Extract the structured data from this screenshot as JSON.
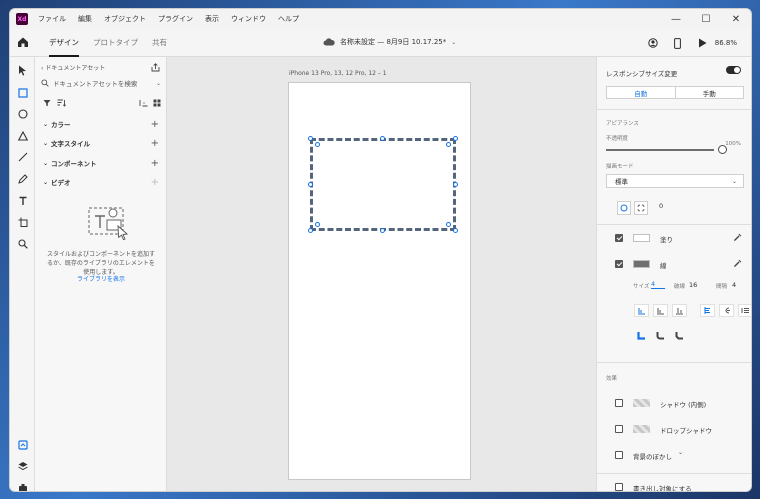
{
  "app": {
    "logo": "Xd",
    "menu": [
      "ファイル",
      "編集",
      "オブジェクト",
      "プラグイン",
      "表示",
      "ウィンドウ",
      "ヘルプ"
    ],
    "window_controls": [
      "—",
      "☐",
      "✕"
    ]
  },
  "toolbar": {
    "tabs": [
      "デザイン",
      "プロトタイプ",
      "共有"
    ],
    "document_title": "名称未設定 — 8月9日 10.17.25",
    "document_title_suffix": "*",
    "zoom": "86.8%"
  },
  "assets": {
    "breadcrumb": "ドキュメントアセット",
    "search_placeholder": "ドキュメントアセットを検索",
    "sections": [
      {
        "label": "カラー"
      },
      {
        "label": "文字スタイル"
      },
      {
        "label": "コンポーネント"
      },
      {
        "label": "ビデオ"
      }
    ],
    "empty_text": "スタイルおよびコンポーネントを追加するか、既存のライブラリのエレメントを使用します。",
    "library_link": "ライブラリを表示"
  },
  "canvas": {
    "artboard_title": "iPhone 13 Pro, 13, 12 Pro, 12 – 1"
  },
  "inspector": {
    "responsive_resize": "レスポンシブサイズ変更",
    "responsive_on": true,
    "mode_auto": "自動",
    "mode_manual": "手動",
    "appearance_heading": "アピアランス",
    "opacity_label": "不透明度",
    "opacity_value": "100%",
    "blend_label": "描画モード",
    "blend_value": "標準",
    "corner_radius": "0",
    "fill_label": "塗り",
    "fill_checked": true,
    "fill_color": "#ffffff",
    "border_label": "線",
    "border_checked": true,
    "border_color": "#707070",
    "size_label": "サイズ",
    "size_value": "4",
    "dash_label": "破線",
    "dash_value": "16",
    "gap_label": "間隔",
    "gap_value": "4",
    "effects_heading": "効果",
    "inner_shadow": "シャドウ (内側)",
    "drop_shadow": "ドロップシャドウ",
    "bg_blur": "背景のぼかし",
    "export_mark": "書き出し対象にする",
    "accent": "#1473e6"
  }
}
